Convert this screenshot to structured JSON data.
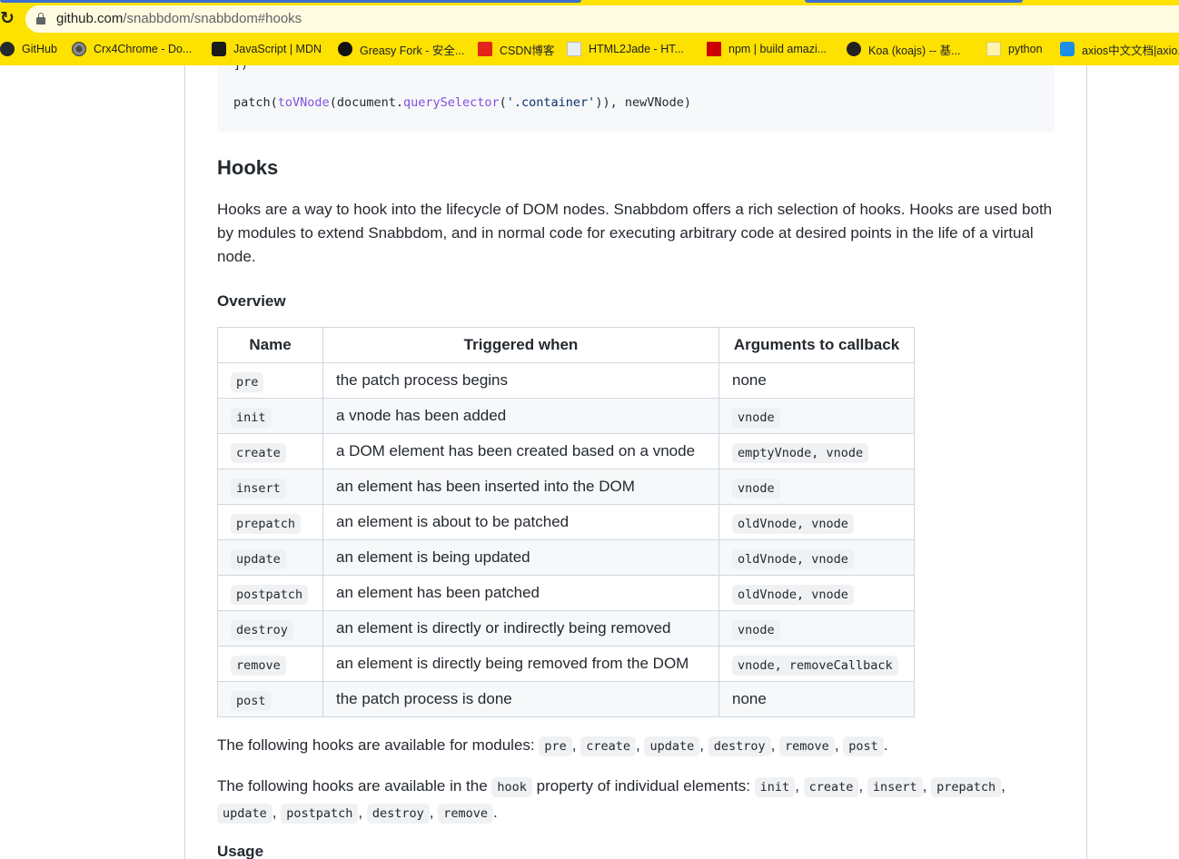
{
  "browser": {
    "url_host": "github.com",
    "url_path": "/snabbdom/snabbdom#hooks",
    "bookmarks": [
      {
        "label": "GitHub"
      },
      {
        "label": "Crx4Chrome - Do..."
      },
      {
        "label": "JavaScript | MDN"
      },
      {
        "label": "Greasy Fork - 安全..."
      },
      {
        "label": "CSDN博客"
      },
      {
        "label": "HTML2Jade - HT..."
      },
      {
        "label": "npm | build amazi..."
      },
      {
        "label": "Koa (koajs) -- 基..."
      },
      {
        "label": "python"
      },
      {
        "label": "axios中文文档|axio..."
      }
    ]
  },
  "code": {
    "line1": "])",
    "patch": "patch(",
    "toVNode": "toVNode",
    "open1": "(document.",
    "querySelector": "querySelector",
    "open2": "(",
    "selector": "'.container'",
    "rest": ")), newVNode)"
  },
  "hooks_section": {
    "title": "Hooks",
    "intro": "Hooks are a way to hook into the lifecycle of DOM nodes. Snabbdom offers a rich selection of hooks. Hooks are used both by modules to extend Snabbdom, and in normal code for executing arbitrary code at desired points in the life of a virtual node.",
    "overview_title": "Overview",
    "table": {
      "headers": [
        "Name",
        "Triggered when",
        "Arguments to callback"
      ],
      "rows": [
        {
          "name": "pre",
          "when": "the patch process begins",
          "args": "none",
          "args_code": false
        },
        {
          "name": "init",
          "when": "a vnode has been added",
          "args": "vnode",
          "args_code": true
        },
        {
          "name": "create",
          "when": "a DOM element has been created based on a vnode",
          "args": "emptyVnode, vnode",
          "args_code": true
        },
        {
          "name": "insert",
          "when": "an element has been inserted into the DOM",
          "args": "vnode",
          "args_code": true
        },
        {
          "name": "prepatch",
          "when": "an element is about to be patched",
          "args": "oldVnode, vnode",
          "args_code": true
        },
        {
          "name": "update",
          "when": "an element is being updated",
          "args": "oldVnode, vnode",
          "args_code": true
        },
        {
          "name": "postpatch",
          "when": "an element has been patched",
          "args": "oldVnode, vnode",
          "args_code": true
        },
        {
          "name": "destroy",
          "when": "an element is directly or indirectly being removed",
          "args": "vnode",
          "args_code": true
        },
        {
          "name": "remove",
          "when": "an element is directly being removed from the DOM",
          "args": "vnode, removeCallback",
          "args_code": true
        },
        {
          "name": "post",
          "when": "the patch process is done",
          "args": "none",
          "args_code": false
        }
      ]
    },
    "modules_sentence": {
      "prefix": "The following hooks are available for modules: ",
      "hooks": [
        "pre",
        "create",
        "update",
        "destroy",
        "remove",
        "post"
      ]
    },
    "elements_sentence": {
      "prefix": "The following hooks are available in the ",
      "hook_word": "hook",
      "middle": " property of individual elements: ",
      "hooks": [
        "init",
        "create",
        "insert",
        "prepatch",
        "update",
        "postpatch",
        "destroy",
        "remove"
      ]
    },
    "usage_title": "Usage"
  }
}
